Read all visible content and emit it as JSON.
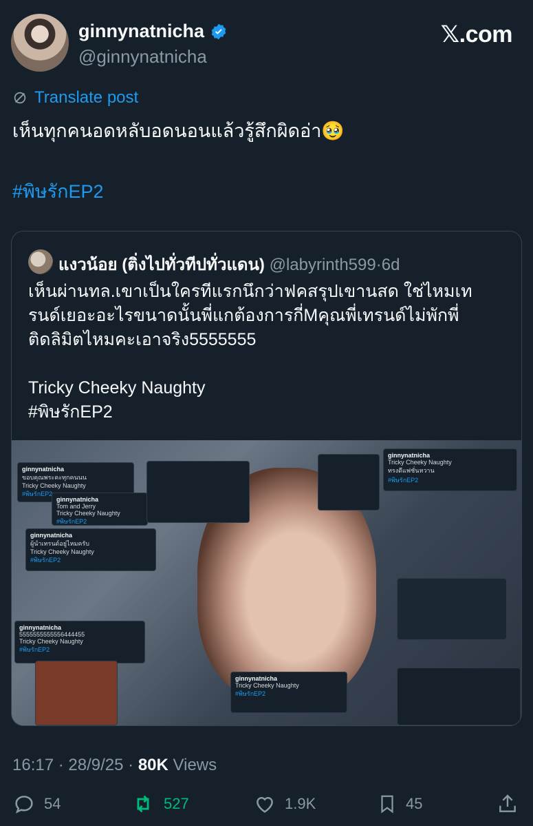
{
  "header": {
    "display_name": "ginnynatnicha",
    "handle": "@ginnynatnicha",
    "site_logo": "𝕏.com"
  },
  "post": {
    "translate_label": "Translate post",
    "text": "เห็นทุกคนอดหลับอดนอนแล้วรู้สึกผิดอ่า🥹",
    "hashtag": "#พิษรักEP2"
  },
  "quote": {
    "name": "แงวน้อย (ติ่งไปทั่วทีปทั่วแดน)",
    "handle": "@labyrinth599",
    "time": "6d",
    "lines": [
      "เห็นผ่านทล.เขาเป็นใครทีแรกนึกว่าฟคสรุปเขานสด ใช่ไหมเท",
      "รนด์เยอะอะไรขนาดนั้นพี่แกต้องการกี่Mคุณพี่เทรนด์ไม่พักพี่",
      "ติดลิมิตไหมคะเอาจริง5555555",
      "Tricky Cheeky Naughty",
      "#พิษรักEP2"
    ]
  },
  "collage_cards": [
    {
      "name": "ginnynatnicha",
      "text": "ขอบคุณพระคะทุกคนนน",
      "tag": "Tricky Cheeky Naughty",
      "hashtag": "#พิษรักEP2"
    },
    {
      "name": "ginnynatnicha",
      "text": "Tom and Jerry",
      "tag": "Tricky Cheeky Naughty",
      "hashtag": "#พิษรักEP2"
    },
    {
      "name": "ginnynatnicha",
      "text": "ผู้นำเทรนด์อยู่ไหมครับ",
      "tag": "Tricky Cheeky Naughty",
      "hashtag": "#พิษรักEP2"
    },
    {
      "name": "ginnynatnicha",
      "text": "5555555555556444455",
      "tag": "Tricky Cheeky Naughty",
      "hashtag": "#พิษรักEP2"
    },
    {
      "name": "ginnynatnicha",
      "text": "Tricky Cheeky Naughty",
      "tag": "ทรงดีแฟชั่นหวาน",
      "hashtag": "#พิษรักEP2"
    },
    {
      "name": "ginnynatnicha",
      "text": "Tricky Cheeky Naughty",
      "tag": "",
      "hashtag": "#พิษรักEP2"
    }
  ],
  "footer": {
    "time": "16:17",
    "date": "28/9/25",
    "views": "80K",
    "views_label": "Views"
  },
  "actions": {
    "replies": "54",
    "reposts": "527",
    "likes": "1.9K",
    "bookmarks": "45"
  },
  "colors": {
    "background": "#15202b",
    "accent": "#1d9bf0",
    "repost_active": "#00ba7c",
    "muted": "#8b98a5"
  }
}
